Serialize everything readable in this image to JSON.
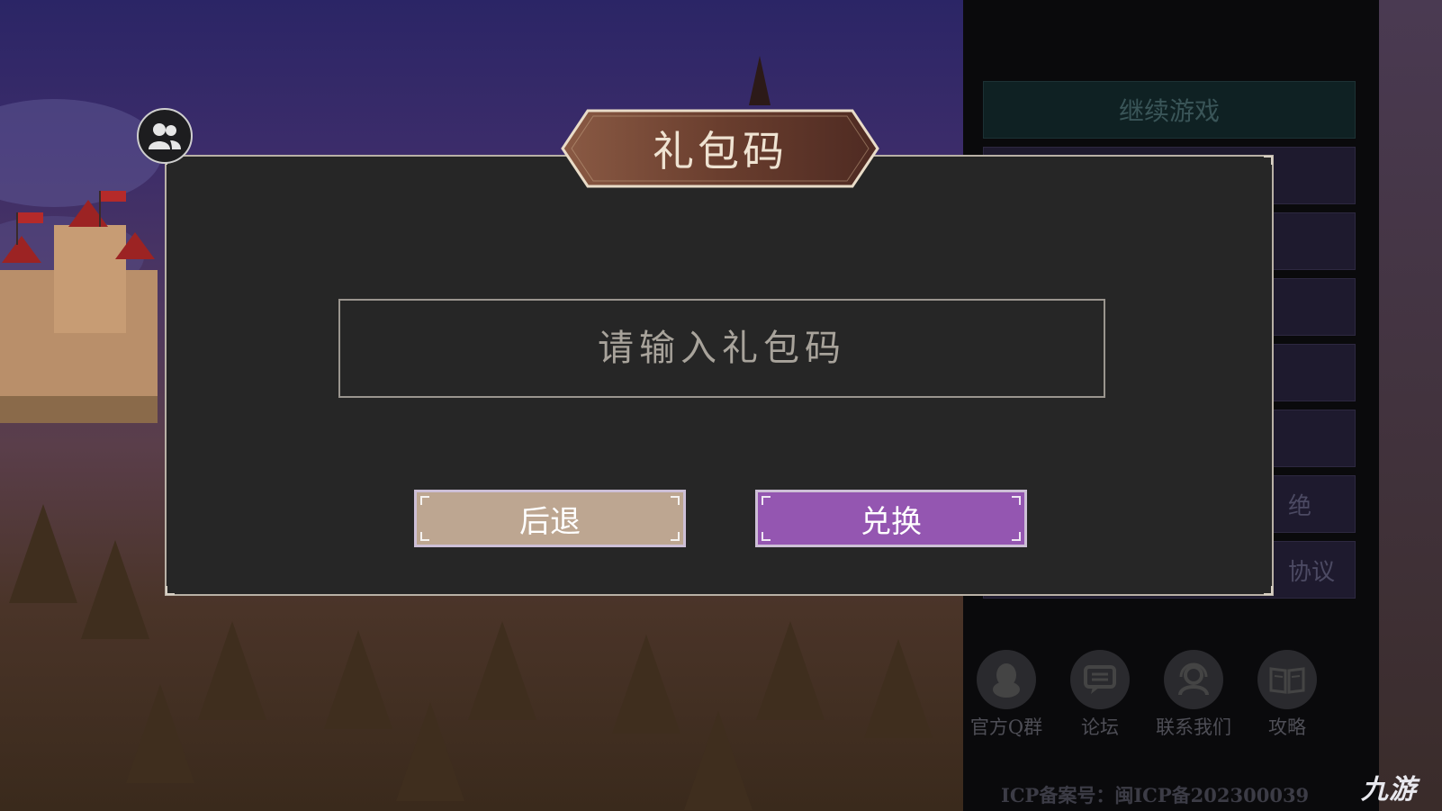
{
  "dialog": {
    "title": "礼包码",
    "input_placeholder": "请输入礼包码",
    "input_value": "",
    "back_label": "后退",
    "redeem_label": "兑换"
  },
  "menu": {
    "items": [
      {
        "label": "继续游戏"
      },
      {
        "label": ""
      },
      {
        "label": ""
      },
      {
        "label": ""
      },
      {
        "label": ""
      },
      {
        "label": ""
      },
      {
        "label": "绝"
      },
      {
        "label": "协议"
      }
    ],
    "social": [
      {
        "label": "官方Q群",
        "icon": "qq-penguin-icon"
      },
      {
        "label": "论坛",
        "icon": "forum-chat-icon"
      },
      {
        "label": "联系我们",
        "icon": "contact-headset-icon"
      },
      {
        "label": "攻略",
        "icon": "guide-book-icon"
      }
    ],
    "icp_text": "ICP备案号：闽ICP备202300039"
  },
  "watermark": "九游",
  "colors": {
    "dialog_bg": "#262626",
    "back_button": "#bda691",
    "redeem_button": "#9456b1",
    "title_plaque": "#7a4a38"
  }
}
